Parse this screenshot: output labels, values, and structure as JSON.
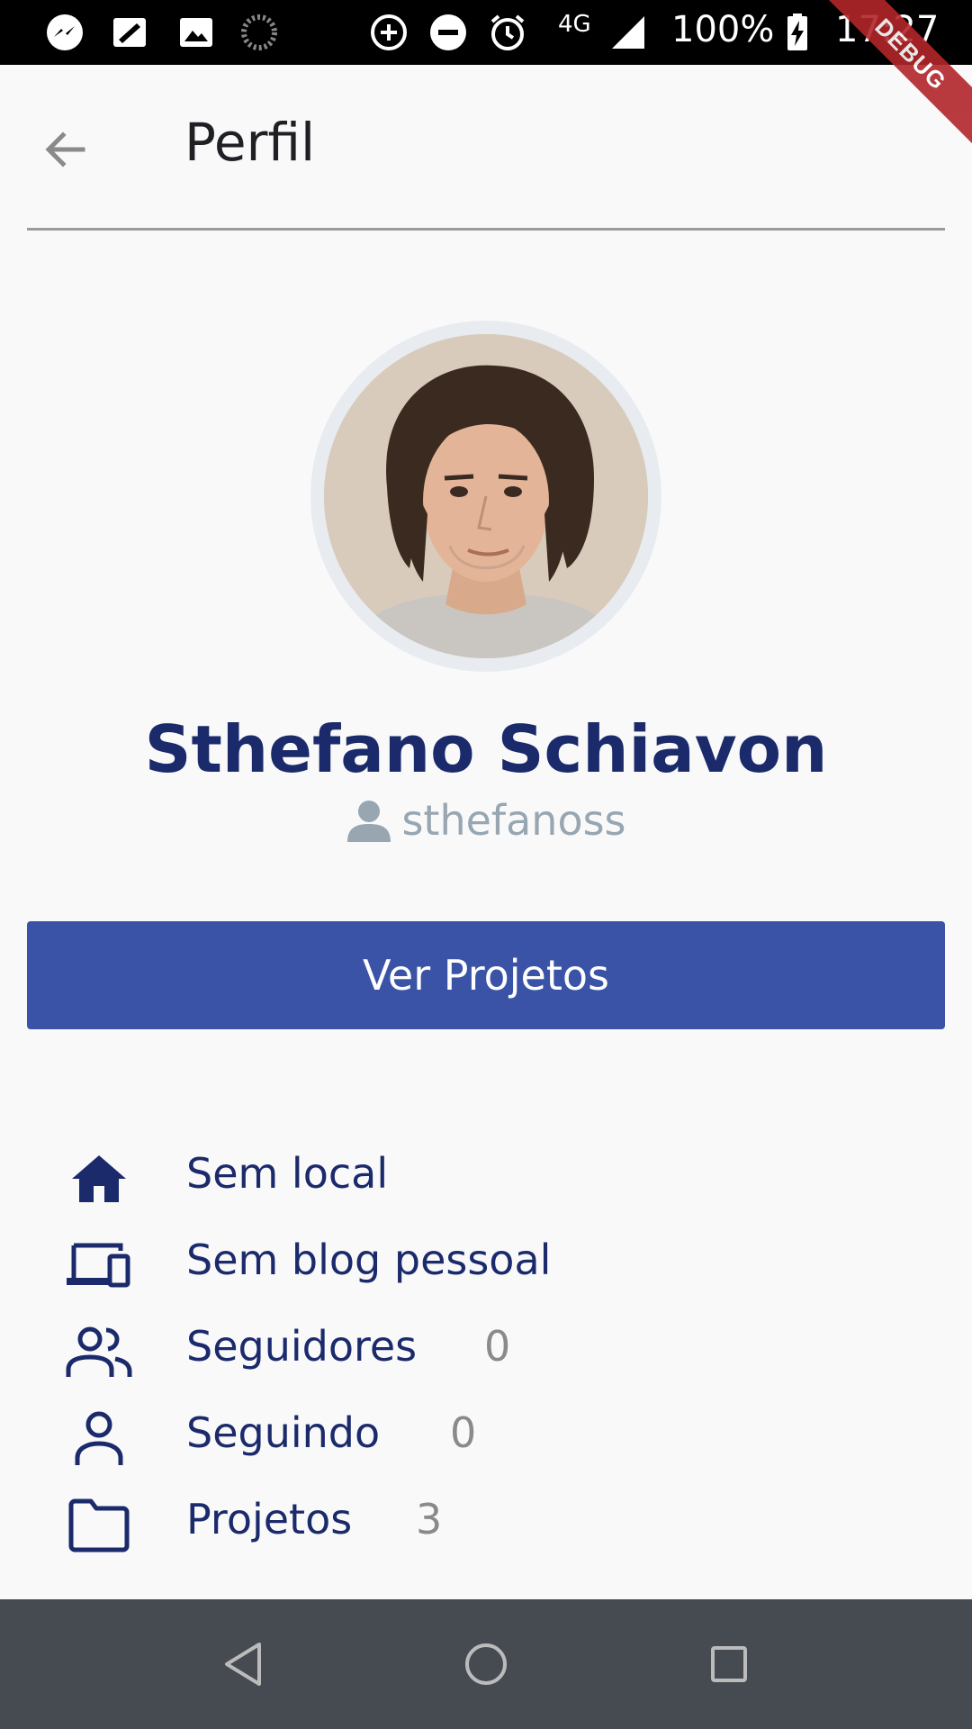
{
  "status_bar": {
    "network": "4G",
    "battery": "100%",
    "time": "17:27"
  },
  "debug_banner": "DEBUG",
  "app_bar": {
    "title": "Perfil"
  },
  "profile": {
    "name": "Sthefano Schiavon",
    "username": "sthefanoss"
  },
  "button": {
    "label": "Ver Projetos"
  },
  "info": [
    {
      "icon": "home-icon",
      "label": "Sem local",
      "count": ""
    },
    {
      "icon": "devices-icon",
      "label": "Sem blog pessoal",
      "count": ""
    },
    {
      "icon": "people-icon",
      "label": "Seguidores",
      "count": "0"
    },
    {
      "icon": "person-icon",
      "label": "Seguindo",
      "count": "0"
    },
    {
      "icon": "folder-icon",
      "label": "Projetos",
      "count": "3"
    }
  ],
  "colors": {
    "primary": "#3a53a6",
    "name_text": "#1b2a6b",
    "username_text": "#97a6b1",
    "nav_bar": "#454b51"
  }
}
